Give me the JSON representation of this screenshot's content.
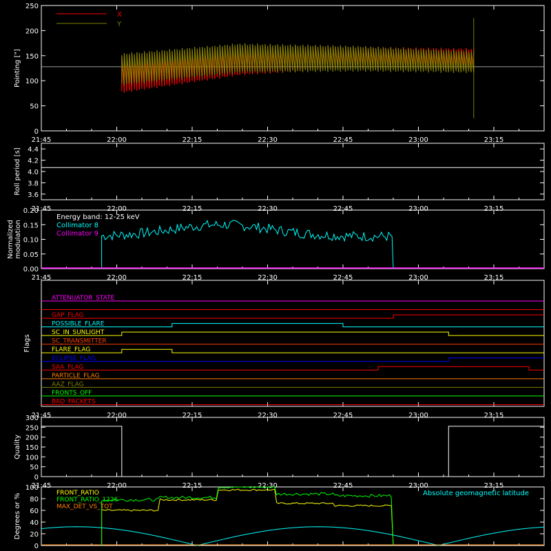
{
  "x_tick_labels": [
    "21:45",
    "22:00",
    "22:15",
    "22:30",
    "22:45",
    "23:00",
    "23:15"
  ],
  "chart_data": [
    {
      "type": "line",
      "ylabel": "Pointing [\"]",
      "ylim": [
        0,
        250
      ],
      "yticks": [
        "0",
        "50",
        "100",
        "150",
        "200",
        "250"
      ],
      "legend": [
        {
          "name": "X",
          "color": "#ff0000"
        },
        {
          "name": "Y",
          "color": "#808000"
        }
      ],
      "legend_position": "top-left",
      "series": [
        {
          "name": "X",
          "color": "#ff0000",
          "start": "22:01",
          "end": "23:11",
          "min": [
            75,
            110,
            125,
            120
          ],
          "max": [
            150,
            170,
            168,
            165
          ]
        },
        {
          "name": "Y",
          "color": "#808000",
          "start": "22:01",
          "end": "23:11",
          "min": [
            90,
            115,
            118,
            115
          ],
          "max": [
            155,
            175,
            170,
            160
          ]
        }
      ],
      "reference_line": 128,
      "spike": {
        "time": "23:11",
        "min": 25,
        "max": 225
      }
    },
    {
      "type": "line",
      "ylabel": "Roll period [s]",
      "ylim": [
        3.5,
        4.5
      ],
      "yticks": [
        "3.6",
        "3.8",
        "4.0",
        "4.2",
        "4.4"
      ],
      "series": [
        {
          "name": "",
          "color": "#ffffff",
          "value": 4.07
        }
      ]
    },
    {
      "type": "line",
      "ylabel_lines": [
        "Normalized",
        "modulation"
      ],
      "ylim": [
        0.0,
        0.2
      ],
      "yticks": [
        "0.00",
        "0.05",
        "0.10",
        "0.15",
        "0.20"
      ],
      "legend": [
        {
          "name": "Energy band: 12-25 keV",
          "color": "#ffffff"
        },
        {
          "name": "Collimator 8",
          "color": "#00ffff"
        },
        {
          "name": "Collimator 9",
          "color": "#ff00ff"
        }
      ],
      "series": [
        {
          "name": "Collimator 8",
          "color": "#00ffff",
          "start": "21:57",
          "end": "22:55",
          "baseline": 0.11,
          "peak_time": "22:21",
          "peak": 0.15
        },
        {
          "name": "Collimator 9",
          "color": "#ff00ff",
          "value": 0.0
        }
      ]
    },
    {
      "type": "line",
      "ylabel": "Flags",
      "flags": [
        {
          "name": "ATTENUATOR_STATE",
          "color": "#ff00ff",
          "transitions": []
        },
        {
          "name": "SAA_FLAG_LINE_TOP",
          "label_hidden": true,
          "color": "#ff0000",
          "transitions": []
        },
        {
          "name": "GAP_FLAG",
          "color": "#ff0000",
          "transitions": [
            {
              "time": "21:58",
              "high": false
            },
            {
              "time": "22:55",
              "high": true
            }
          ]
        },
        {
          "name": "POSSIBLE_FLARE",
          "color": "#00ffff",
          "transitions": [
            {
              "time": "22:11",
              "high": true
            },
            {
              "time": "22:45",
              "high": false
            }
          ]
        },
        {
          "name": "SC_IN_SUNLIGHT",
          "color": "#ffff00",
          "transitions": [
            {
              "time": "22:01",
              "high": true
            },
            {
              "time": "23:06",
              "high": false
            }
          ]
        },
        {
          "name": "SC_TRANSMITTER",
          "color": "#ff4000",
          "transitions": []
        },
        {
          "name": "FLARE_FLAG",
          "color": "#ffff00",
          "transitions": [
            {
              "time": "22:01",
              "high": true
            },
            {
              "time": "22:11",
              "high": false
            }
          ]
        },
        {
          "name": "ECLIPSE_FLAG",
          "color": "#0000ff",
          "transitions": [
            {
              "time": "22:01",
              "high": false
            },
            {
              "time": "23:06",
              "high": true
            }
          ]
        },
        {
          "name": "SAA_FLAG",
          "color": "#ff0000",
          "transitions": [
            {
              "time": "22:52",
              "high": true
            },
            {
              "time": "23:22",
              "high": false
            }
          ]
        },
        {
          "name": "PARTICLE_FLAG",
          "color": "#ff8000",
          "transitions": []
        },
        {
          "name": "AAZ_FLAG",
          "color": "#808000",
          "transitions": []
        },
        {
          "name": "FRONTS_OFF",
          "color": "#00ff00",
          "transitions": []
        },
        {
          "name": "BAD_PACKETS",
          "color": "#ff0000",
          "transitions": []
        }
      ]
    },
    {
      "type": "line",
      "ylabel": "Quality",
      "ylim": [
        0,
        300
      ],
      "yticks": [
        "0",
        "50",
        "100",
        "150",
        "200",
        "250",
        "300"
      ],
      "series": [
        {
          "name": "",
          "color": "#ffffff",
          "segments": [
            {
              "start": "21:45",
              "end": "22:01",
              "value": 255
            },
            {
              "start": "22:01",
              "end": "23:06",
              "value": 0
            },
            {
              "start": "23:06",
              "end": "23:25",
              "value": 255
            }
          ]
        }
      ]
    },
    {
      "type": "line",
      "ylabel": "Degrees or %",
      "ylim": [
        0,
        100
      ],
      "yticks": [
        "0",
        "20",
        "40",
        "60",
        "80",
        "100"
      ],
      "legend": [
        {
          "name": "FRONT_RATIO",
          "color": "#ffff00"
        },
        {
          "name": "FRONT_RATIO_1236",
          "color": "#00ff00"
        },
        {
          "name": "MAX_DET_VS_TOT",
          "color": "#ff8000"
        }
      ],
      "legend_right": {
        "name": "Absolute geomagnetic latitude",
        "color": "#00ffff"
      },
      "series": [
        {
          "name": "FRONT_RATIO",
          "color": "#ffff00",
          "start": "21:57",
          "end": "22:55",
          "levels": [
            60,
            78,
            95,
            72,
            68
          ]
        },
        {
          "name": "FRONT_RATIO_1236",
          "color": "#00ff00",
          "start": "21:57",
          "end": "22:55",
          "levels": [
            78,
            82,
            100,
            88,
            85
          ]
        },
        {
          "name": "MAX_DET_VS_TOT",
          "color": "#ff8000",
          "value": 0
        },
        {
          "name": "Absolute geomagnetic latitude",
          "color": "#00ffff",
          "period_minutes": 48,
          "max": 32
        }
      ]
    }
  ]
}
